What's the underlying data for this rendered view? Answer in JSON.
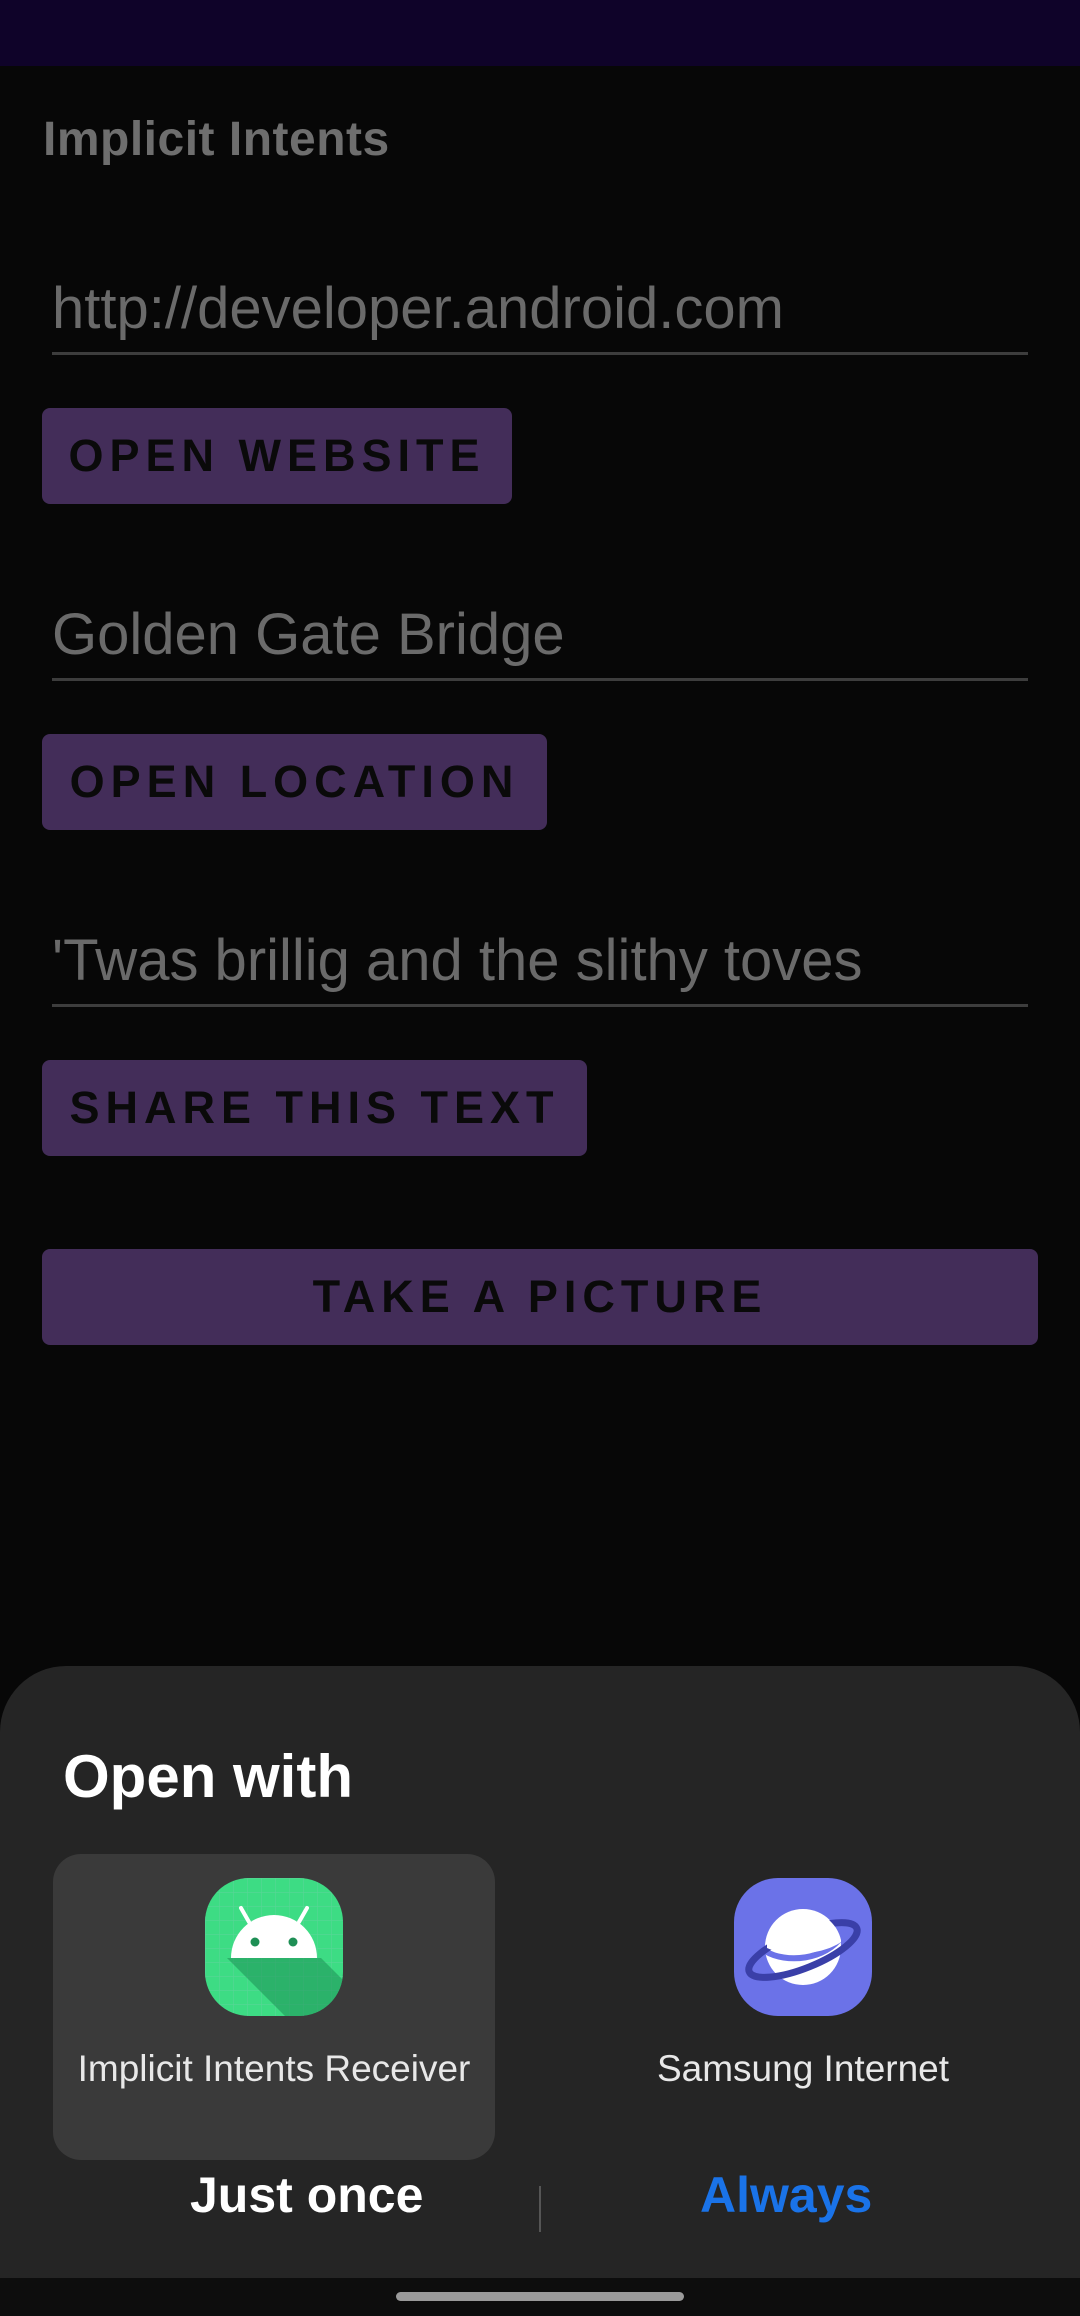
{
  "app": {
    "title": "Implicit Intents"
  },
  "form": {
    "website_field": {
      "value": "http://developer.android.com"
    },
    "website_button": "OPEN WEBSITE",
    "location_field": {
      "value": "Golden Gate Bridge"
    },
    "location_button": "OPEN LOCATION",
    "share_field": {
      "value": "'Twas brillig and the slithy toves"
    },
    "share_button": "SHARE THIS TEXT",
    "picture_button": "TAKE A PICTURE"
  },
  "chooser": {
    "title": "Open with",
    "options": [
      {
        "label": "Implicit Intents Receiver",
        "icon": "android-icon",
        "selected": true
      },
      {
        "label": "Samsung Internet",
        "icon": "samsung-internet-icon",
        "selected": false
      }
    ],
    "just_once": "Just once",
    "always": "Always"
  },
  "colors": {
    "status_bar": "#0f0329",
    "button": "#432d59",
    "sheet": "#252525",
    "always_accent": "#1a73e8"
  }
}
